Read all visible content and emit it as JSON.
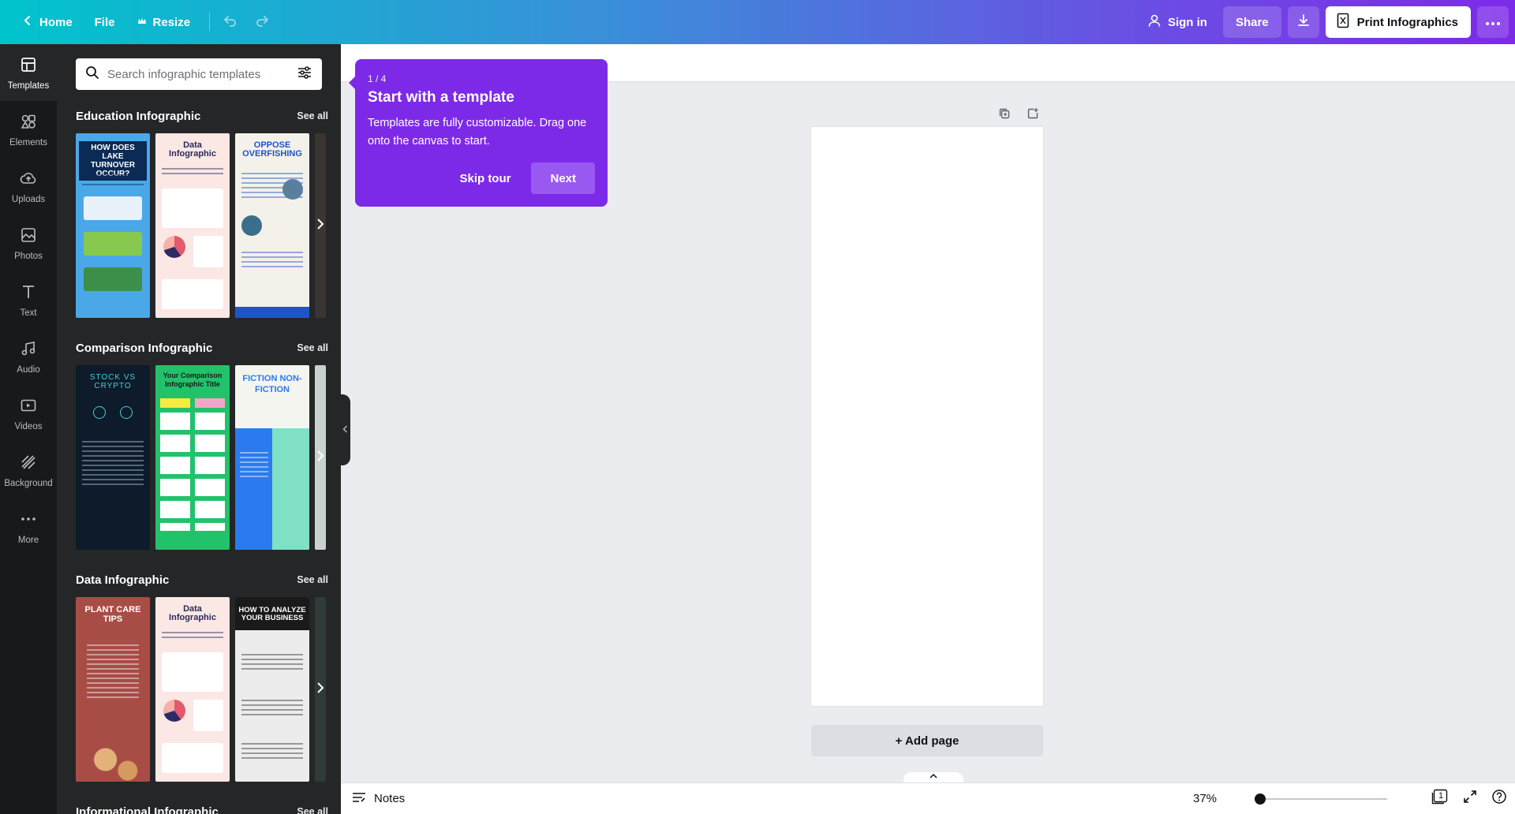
{
  "topbar": {
    "home": "Home",
    "file": "File",
    "resize": "Resize",
    "sign_in": "Sign in",
    "share": "Share",
    "print": "Print Infographics"
  },
  "rail": [
    {
      "label": "Templates",
      "icon": "templates-icon"
    },
    {
      "label": "Elements",
      "icon": "elements-icon"
    },
    {
      "label": "Uploads",
      "icon": "uploads-icon"
    },
    {
      "label": "Photos",
      "icon": "photos-icon"
    },
    {
      "label": "Text",
      "icon": "text-icon"
    },
    {
      "label": "Audio",
      "icon": "audio-icon"
    },
    {
      "label": "Videos",
      "icon": "videos-icon"
    },
    {
      "label": "Background",
      "icon": "background-icon"
    },
    {
      "label": "More",
      "icon": "more-icon"
    }
  ],
  "search": {
    "placeholder": "Search infographic templates"
  },
  "sections": [
    {
      "title": "Education Infographic",
      "see_all": "See all",
      "thumbs": [
        {
          "text": "HOW DOES LAKE TURNOVER OCCUR?",
          "bg": "#4aa8e8",
          "fg": "#0b2a55"
        },
        {
          "text": "Data Infographic",
          "bg": "#fbe7e4",
          "fg": "#2a2a5a"
        },
        {
          "text": "OPPOSE OVERFISHING",
          "bg": "#f4f1ea",
          "fg": "#1f54c9"
        }
      ]
    },
    {
      "title": "Comparison Infographic",
      "see_all": "See all",
      "thumbs": [
        {
          "text": "STOCK VS CRYPTO",
          "bg": "#0d1b2a",
          "fg": "#3fd0d6"
        },
        {
          "text": "Your Comparison Infographic Title",
          "bg": "#22c26a",
          "fg": "#1a1a1a"
        },
        {
          "text": "FICTION NON-FICTION",
          "bg": "#2a7bef",
          "fg": "#ffffff"
        }
      ]
    },
    {
      "title": "Data Infographic",
      "see_all": "See all",
      "thumbs": [
        {
          "text": "PLANT CARE TIPS",
          "bg": "#a84c46",
          "fg": "#ffffff"
        },
        {
          "text": "Data Infographic",
          "bg": "#fbe7e4",
          "fg": "#2a2a5a"
        },
        {
          "text": "HOW TO ANALYZE YOUR BUSINESS",
          "bg": "#ececec",
          "fg": "#111111"
        }
      ]
    },
    {
      "title": "Informational Infographic",
      "see_all": "See all",
      "thumbs": []
    }
  ],
  "tour": {
    "step": "1 / 4",
    "title": "Start with a template",
    "body": "Templates are fully customizable. Drag one onto the canvas to start.",
    "skip": "Skip tour",
    "next": "Next"
  },
  "canvas": {
    "add_page": "+ Add page"
  },
  "bottombar": {
    "notes": "Notes",
    "zoom": "37%",
    "zoom_fraction": 0.04,
    "page_count": "1"
  },
  "colors": {
    "accent": "#7d2ae8",
    "teal": "#00c4cc",
    "panel": "#252627",
    "rail": "#18191b"
  }
}
